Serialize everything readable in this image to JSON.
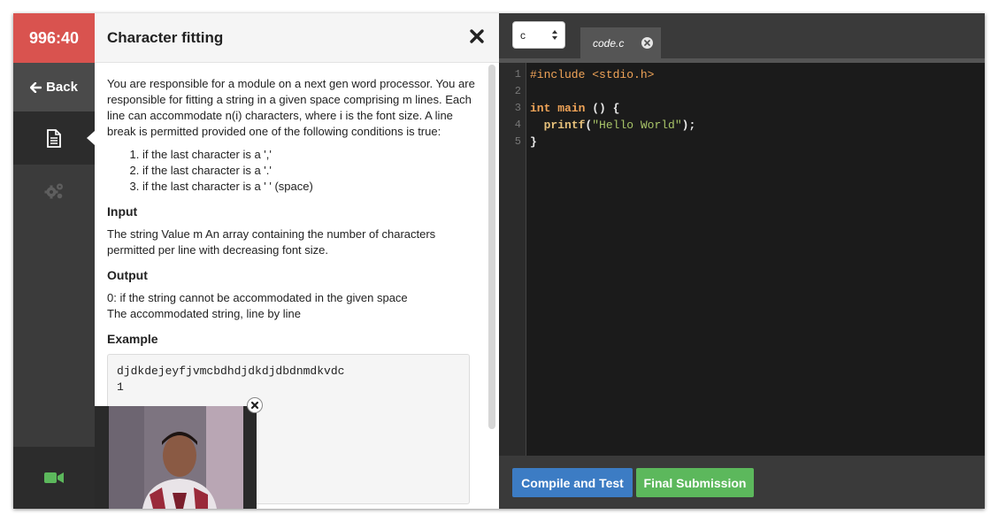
{
  "timer": "996:40",
  "nav": {
    "back_label": "Back",
    "items": [
      "document-icon",
      "gears-icon",
      "video-camera-icon"
    ]
  },
  "problem": {
    "title": "Character fitting",
    "description": "You are responsible for a module on a next gen word processor. You are responsible for fitting a string in a given space comprising m lines. Each line can accommodate n(i) characters, where i is the font size. A line break is permitted provided one of the following conditions is true:",
    "conditions": [
      "if the last character is a ','",
      "if the last character is a '.'",
      "if the last character is a ' ' (space)"
    ],
    "input_heading": "Input",
    "input_text": "The string Value m An array containing the number of characters permitted per line with decreasing font size.",
    "output_heading": "Output",
    "output_lines": [
      "0: if the string cannot be accommodated in the given space",
      "The accommodated string, line by line"
    ],
    "example_heading": "Example",
    "example_lines": [
      "djdkdejeyfjvmcbdhdjdkdjdbdnmdkvdc",
      "1"
    ]
  },
  "editor": {
    "language": "c",
    "file_tab": "code.c",
    "line_numbers": [
      "1",
      "2",
      "3",
      "4",
      "5"
    ],
    "code": {
      "include": "#include <stdio.h>",
      "int_kw": "int",
      "main_kw": "main",
      "main_rest": " () {",
      "printf_indent": "  ",
      "printf_kw": "printf",
      "open_paren": "(",
      "string": "\"Hello World\"",
      "close": ");",
      "brace": "}"
    },
    "compile_button": "Compile and Test",
    "final_button": "Final Submission"
  },
  "colors": {
    "timer_bg": "#d9534f",
    "compile_bg": "#3c7cc4",
    "final_bg": "#5cb85c",
    "video_icon": "#5cb85c"
  }
}
